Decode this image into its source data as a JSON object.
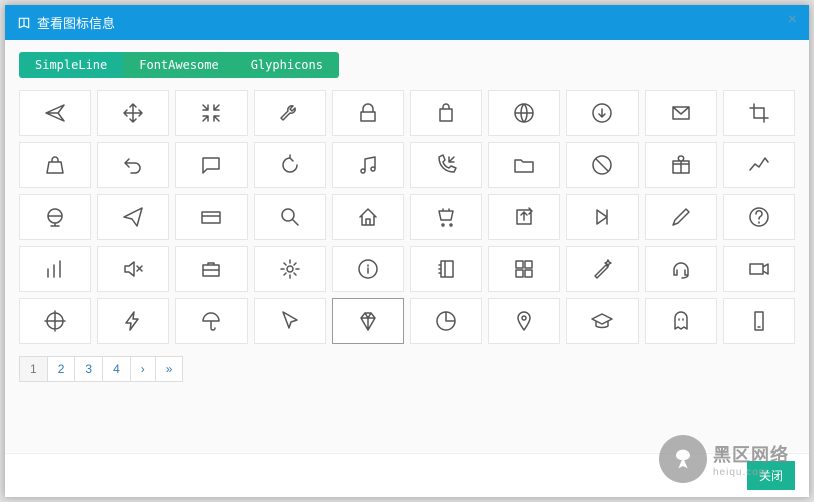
{
  "modal": {
    "title": "查看图标信息"
  },
  "tabs": [
    {
      "label": "SimpleLine",
      "active": true
    },
    {
      "label": "FontAwesome",
      "active": false
    },
    {
      "label": "Glyphicons",
      "active": false
    }
  ],
  "icons": [
    {
      "name": "plane-icon"
    },
    {
      "name": "move-icon"
    },
    {
      "name": "shrink-icon"
    },
    {
      "name": "wrench-icon"
    },
    {
      "name": "lock-icon"
    },
    {
      "name": "bag-icon"
    },
    {
      "name": "globe-icon"
    },
    {
      "name": "download-icon"
    },
    {
      "name": "envelope-icon"
    },
    {
      "name": "crop-icon"
    },
    {
      "name": "handbag-icon"
    },
    {
      "name": "undo-icon"
    },
    {
      "name": "chat-icon"
    },
    {
      "name": "reload-icon"
    },
    {
      "name": "music-icon"
    },
    {
      "name": "call-in-icon"
    },
    {
      "name": "folder-icon"
    },
    {
      "name": "ban-icon"
    },
    {
      "name": "gift-icon"
    },
    {
      "name": "graph-icon"
    },
    {
      "name": "globe2-icon"
    },
    {
      "name": "paper-plane-icon"
    },
    {
      "name": "credit-card-icon"
    },
    {
      "name": "search-icon"
    },
    {
      "name": "home-icon"
    },
    {
      "name": "cart-icon"
    },
    {
      "name": "share-icon"
    },
    {
      "name": "prev-icon"
    },
    {
      "name": "pencil-icon"
    },
    {
      "name": "question-icon"
    },
    {
      "name": "chart-icon"
    },
    {
      "name": "mute-icon"
    },
    {
      "name": "briefcase-icon"
    },
    {
      "name": "gear-icon"
    },
    {
      "name": "info-icon"
    },
    {
      "name": "notebook-icon"
    },
    {
      "name": "grid-icon"
    },
    {
      "name": "wand-icon"
    },
    {
      "name": "headset-icon"
    },
    {
      "name": "video-icon"
    },
    {
      "name": "target-icon"
    },
    {
      "name": "energy-icon"
    },
    {
      "name": "umbrella-icon"
    },
    {
      "name": "cursor-icon"
    },
    {
      "name": "diamond-icon",
      "selected": true
    },
    {
      "name": "pie-icon"
    },
    {
      "name": "pin-icon"
    },
    {
      "name": "graduation-icon"
    },
    {
      "name": "ghost-icon"
    },
    {
      "name": "phone-icon"
    }
  ],
  "pagination": {
    "pages": [
      "1",
      "2",
      "3",
      "4",
      "›",
      "»"
    ],
    "active": 0
  },
  "footer": {
    "close_label": "关闭"
  },
  "watermark": {
    "text": "黑区网络",
    "sub": "heiqu.com"
  }
}
